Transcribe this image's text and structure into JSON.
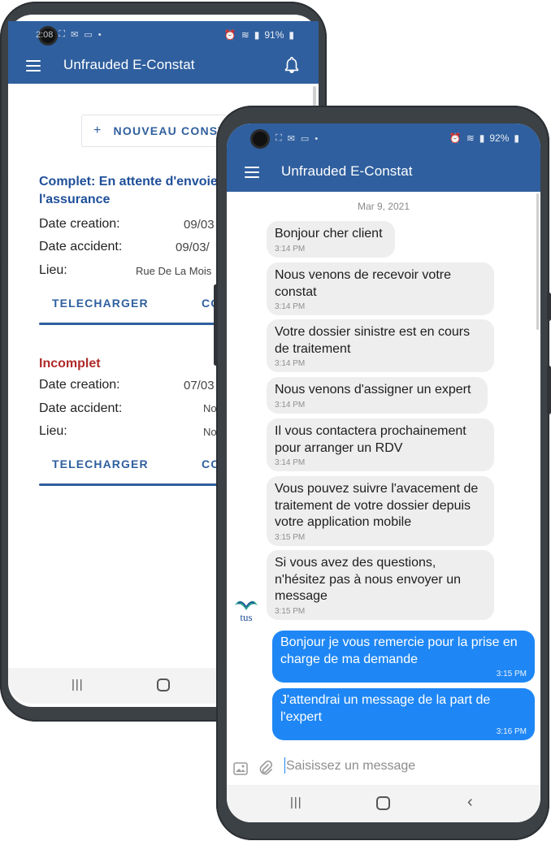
{
  "colors": {
    "primary": "#2f5f9e",
    "complete_status": "#1f4f99",
    "incomplete_status": "#b02a2a",
    "outgoing_bubble": "#1f87f5",
    "incoming_bubble": "#eeeeee"
  },
  "left_phone": {
    "status_bar": {
      "time": "2:08",
      "battery": "91%"
    },
    "app_bar": {
      "title": "Unfrauded E-Constat",
      "menu_icon": "hamburger-icon",
      "notif_icon": "bell-icon"
    },
    "new_button": {
      "plus": "+",
      "label": "NOUVEAU CONSTAT"
    },
    "cards": [
      {
        "status": "Complet: En attente d'envoie à l'assurance",
        "status_line1": "Complet: En attente d'envoie",
        "status_line2": "l'assurance",
        "rows": [
          {
            "label": "Date creation:",
            "value": "09/03"
          },
          {
            "label": "Date accident:",
            "value": "09/03/"
          },
          {
            "label": "Lieu:",
            "value": "Rue De La Mois"
          }
        ],
        "actions": [
          "TELECHARGER",
          "CO"
        ]
      },
      {
        "status": "Incomplet",
        "rows": [
          {
            "label": "Date creation:",
            "value": "07/03"
          },
          {
            "label": "Date accident:",
            "value": "No"
          },
          {
            "label": "Lieu:",
            "value": "No"
          }
        ],
        "actions": [
          "TELECHARGER",
          "CO"
        ]
      }
    ],
    "nav": {
      "recents_icon": "recents-icon",
      "home_icon": "home-icon"
    }
  },
  "right_phone": {
    "status_bar": {
      "battery": "92%"
    },
    "app_bar": {
      "title": "Unfrauded E-Constat",
      "menu_icon": "hamburger-icon"
    },
    "chat": {
      "date": "Mar 9, 2021",
      "messages": [
        {
          "dir": "in",
          "text": "Bonjour cher client",
          "time": "3:14 PM"
        },
        {
          "dir": "in",
          "text": "Nous venons de recevoir votre constat",
          "time": "3:14 PM"
        },
        {
          "dir": "in",
          "text": "Votre dossier sinistre est en cours de traitement",
          "time": "3:14 PM"
        },
        {
          "dir": "in",
          "text": "Nous venons d'assigner un expert",
          "time": "3:14 PM"
        },
        {
          "dir": "in",
          "text": "Il vous contactera prochainement pour arranger un RDV",
          "time": "3:14 PM"
        },
        {
          "dir": "in",
          "text": "Vous pouvez suivre l'avacement de traitement de votre dossier depuis votre application mobile",
          "time": "3:15 PM"
        },
        {
          "dir": "in",
          "text": "Si vous avez des questions, n'hésitez pas à nous envoyer un message",
          "time": "3:15 PM"
        },
        {
          "dir": "out",
          "text": "Bonjour je vous remercie pour la prise en charge de ma demande",
          "time": "3:15 PM"
        },
        {
          "dir": "out",
          "text": "J'attendrai un message de la part de l'expert",
          "time": "3:16 PM"
        }
      ],
      "avatar_text": "tus"
    },
    "composer": {
      "placeholder": "Saisissez un message",
      "image_icon": "image-icon",
      "attach_icon": "paperclip-icon"
    },
    "nav": {
      "recents_icon": "recents-icon",
      "home_icon": "home-icon",
      "back_icon": "back-icon"
    }
  }
}
